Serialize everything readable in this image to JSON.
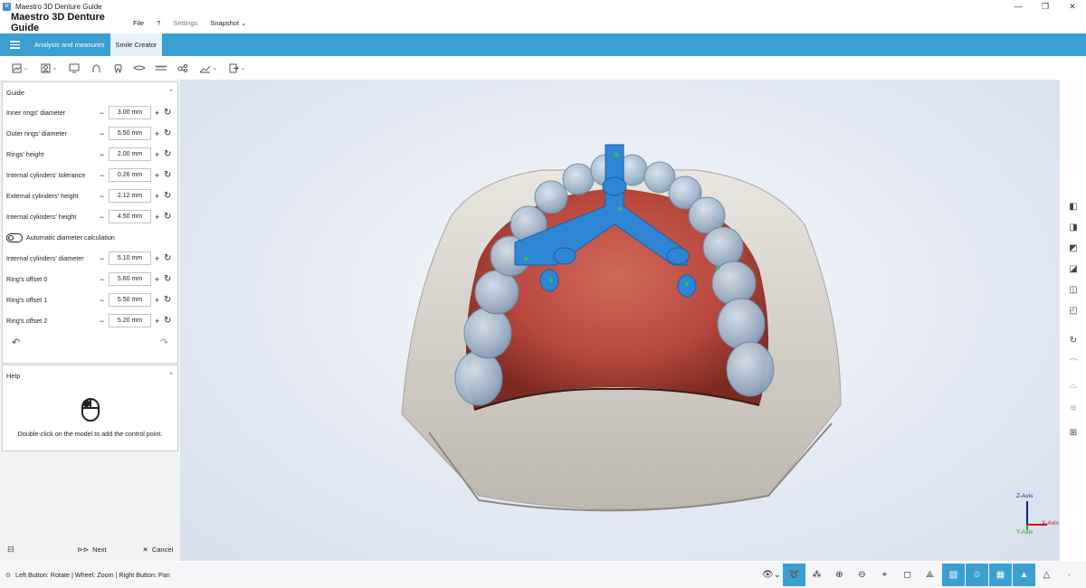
{
  "window": {
    "title": "Maestro 3D Denture Guide",
    "controls": [
      "—",
      "❐",
      "✕"
    ]
  },
  "menubar": {
    "brand": "Maestro 3D Denture Guide",
    "items": [
      {
        "label": "File",
        "dim": false
      },
      {
        "label": "?",
        "dim": false
      },
      {
        "label": "Settings",
        "dim": true
      },
      {
        "label": "Snapshot",
        "dim": false
      }
    ]
  },
  "ribbon": {
    "tabs": [
      {
        "label": "Analysis and measures",
        "active": false
      },
      {
        "label": "Smile Creator",
        "active": true
      }
    ]
  },
  "guide": {
    "title": "Guide",
    "params_top": [
      {
        "label": "Inner rings' diameter",
        "value": "3.00 mm"
      },
      {
        "label": "Outer rings' diameter",
        "value": "5.50 mm"
      },
      {
        "label": "Rings' height",
        "value": "2.00 mm"
      },
      {
        "label": "Internal cylinders' tolerance",
        "value": "0.26 mm"
      },
      {
        "label": "External cylinders' height",
        "value": "2.12 mm"
      },
      {
        "label": "Internal cylinders' height",
        "value": "4.50 mm"
      }
    ],
    "toggle_label": "Automatic diameter calculation",
    "params_bottom": [
      {
        "label": "Internal cylinders' diameter",
        "value": "5.10 mm"
      },
      {
        "label": "Ring's offset 0",
        "value": "5.60 mm"
      },
      {
        "label": "Ring's offset 1",
        "value": "5.50 mm"
      },
      {
        "label": "Ring's offset 2",
        "value": "5.20 mm"
      }
    ]
  },
  "help": {
    "title": "Help",
    "text": "Double-click on the model to add the control point."
  },
  "footer": {
    "next": "Next",
    "cancel": "Cancel"
  },
  "status": {
    "text": "Left Button: Rotate | Wheel: Zoom | Right Button: Pan"
  },
  "axes": {
    "z": "Z-Axis",
    "x": "X-Axis",
    "y": "Y-Axis"
  }
}
